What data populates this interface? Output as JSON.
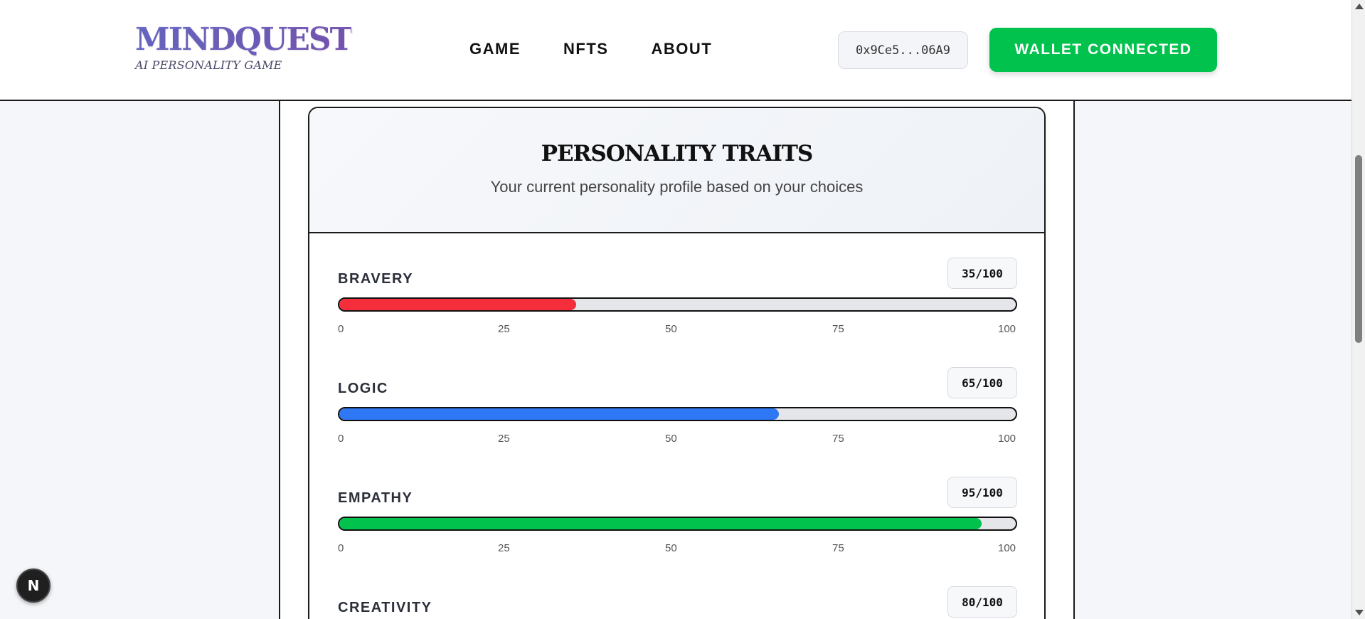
{
  "header": {
    "logo_title": "MINDQUEST",
    "logo_subtitle": "AI PERSONALITY GAME",
    "nav": [
      "GAME",
      "NFTS",
      "ABOUT"
    ],
    "wallet_address": "0x9Ce5...06A9",
    "wallet_button": "WALLET CONNECTED"
  },
  "card": {
    "title": "PERSONALITY TRAITS",
    "subtitle": "Your current personality profile based on your choices"
  },
  "scale_ticks": [
    "0",
    "25",
    "50",
    "75",
    "100"
  ],
  "traits": [
    {
      "name": "BRAVERY",
      "value_label": "35/100",
      "value": 35,
      "color": "#f62d3a"
    },
    {
      "name": "LOGIC",
      "value_label": "65/100",
      "value": 65,
      "color": "#2f78f5"
    },
    {
      "name": "EMPATHY",
      "value_label": "95/100",
      "value": 95,
      "color": "#00c24d"
    },
    {
      "name": "CREATIVITY",
      "value_label": "80/100",
      "value": 80,
      "color": "#a855f7"
    }
  ],
  "dev_badge": "N",
  "colors": {
    "accent_green": "#00c24d",
    "logo_purple": "#6c5fc0"
  }
}
